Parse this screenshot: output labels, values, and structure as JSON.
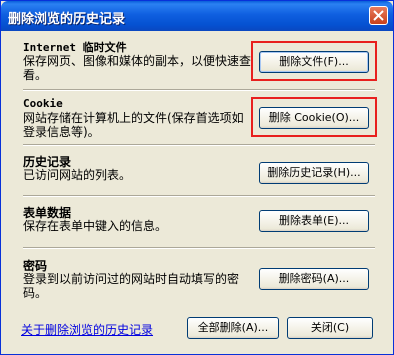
{
  "window": {
    "title": "删除浏览的历史记录"
  },
  "sections": [
    {
      "title": "Internet 临时文件",
      "desc": "保存网页、图像和媒体的副本，以便快速查看。",
      "button": "删除文件(F)..."
    },
    {
      "title": "Cookie",
      "desc": "网站存储在计算机上的文件(保存首选项如登录信息等)。",
      "button": "删除 Cookie(O)..."
    },
    {
      "title": "历史记录",
      "desc": "已访问网站的列表。",
      "button": "删除历史记录(H)..."
    },
    {
      "title": "表单数据",
      "desc": "保存在表单中键入的信息。",
      "button": "删除表单(E)..."
    },
    {
      "title": "密码",
      "desc": "登录到以前访问过的网站时自动填写的密码。",
      "button": "删除密码(A)..."
    }
  ],
  "footer": {
    "link": "关于删除浏览的历史记录",
    "delete_all": "全部删除(A)...",
    "close": "关闭(C)"
  },
  "highlight_color": "#e8201e"
}
